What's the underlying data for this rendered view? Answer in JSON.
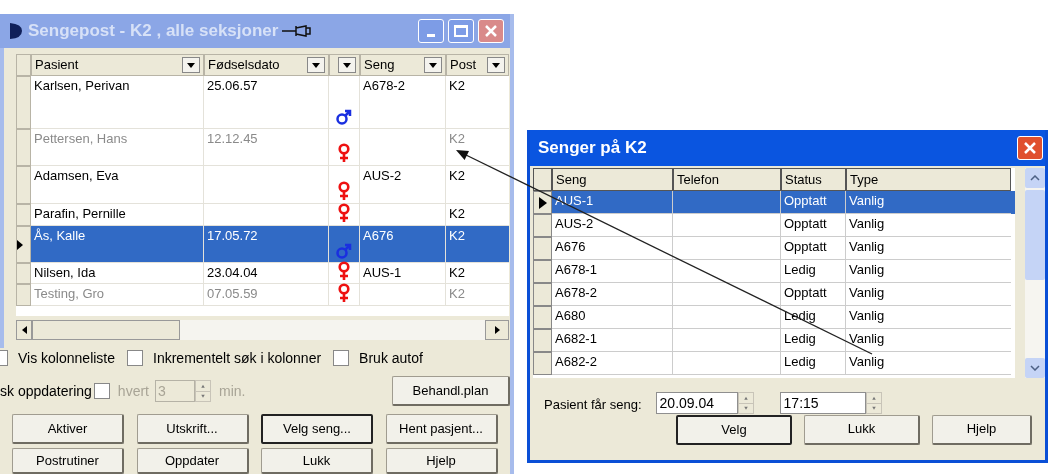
{
  "main_window": {
    "title": "Sengepost - K2 , alle seksjoner",
    "active": false,
    "columns": [
      {
        "kind": "text",
        "label": "Pasient"
      },
      {
        "kind": "text",
        "label": "Fødselsdato"
      },
      {
        "kind": "gender"
      },
      {
        "kind": "text",
        "label": "Seng"
      },
      {
        "kind": "text",
        "label": "Post"
      }
    ],
    "rows": [
      {
        "name": "Karlsen, Perivan",
        "birth_date": "25.06.57",
        "kind": "male",
        "bed": "A678-2",
        "post": "K2",
        "inactive": false,
        "selected": false
      },
      {
        "name": "Pettersen, Hans",
        "birth_date": "12.12.45",
        "kind": "female",
        "post": "K2",
        "inactive": true,
        "selected": false
      },
      {
        "name": "Adamsen, Eva",
        "kind": "female",
        "bed": "AUS-2",
        "post": "K2",
        "inactive": false,
        "selected": false
      },
      {
        "name": "Parafin, Pernille",
        "kind": "female",
        "post": "K2",
        "inactive": false,
        "selected": false
      },
      {
        "name": "Ås, Kalle",
        "birth_date": "17.05.72",
        "kind": "male",
        "bed": "A676",
        "post": "K2",
        "inactive": false,
        "selected": true
      },
      {
        "name": "Nilsen, Ida",
        "birth_date": "23.04.04",
        "kind": "female",
        "bed": "AUS-1",
        "post": "K2",
        "inactive": false,
        "selected": false
      },
      {
        "name": "Testing, Gro",
        "birth_date": "07.05.59",
        "kind": "female",
        "post": "K2",
        "inactive": true,
        "selected": false
      }
    ],
    "options": [
      {
        "label": "Vis kolonneliste",
        "checked": false
      },
      {
        "label": "Inkrementelt søk i kolonner",
        "checked": false
      },
      {
        "label": "Bruk autof",
        "checked": false
      }
    ],
    "auto_update": {
      "label": "sk oppdatering",
      "checked": false,
      "every_label": "hvert",
      "interval": "3",
      "unit": "min."
    },
    "side_button": "Behandl.plan",
    "buttons": [
      {
        "label": "Aktiver",
        "default": false
      },
      {
        "label": "Utskrift...",
        "default": false
      },
      {
        "label": "Velg seng...",
        "default": true
      },
      {
        "label": "Hent pasjent...",
        "default": false
      },
      {
        "label": "Postrutiner",
        "default": false
      },
      {
        "label": "Oppdater",
        "default": false
      },
      {
        "label": "Lukk",
        "default": false
      },
      {
        "label": "Hjelp",
        "default": false
      }
    ]
  },
  "bed_dialog": {
    "title": "Senger på K2",
    "active": true,
    "columns": [
      "Seng",
      "Telefon",
      "Status",
      "Type"
    ],
    "rows": [
      {
        "bed": "AUS-1",
        "status": "Opptatt",
        "type": "Vanlig",
        "selected": true
      },
      {
        "bed": "AUS-2",
        "status": "Opptatt",
        "type": "Vanlig",
        "selected": false
      },
      {
        "bed": "A676",
        "status": "Opptatt",
        "type": "Vanlig",
        "selected": false
      },
      {
        "bed": "A678-1",
        "status": "Ledig",
        "type": "Vanlig",
        "selected": false
      },
      {
        "bed": "A678-2",
        "status": "Opptatt",
        "type": "Vanlig",
        "selected": false
      },
      {
        "bed": "A680",
        "status": "Ledig",
        "type": "Vanlig",
        "selected": false
      },
      {
        "bed": "A682-1",
        "status": "Ledig",
        "type": "Vanlig",
        "selected": false
      },
      {
        "bed": "A682-2",
        "status": "Ledig",
        "type": "Vanlig",
        "selected": false
      }
    ],
    "assign_label": "Pasient får seng:",
    "date": "20.09.04",
    "time": "17:15",
    "buttons": [
      {
        "label": "Velg",
        "default": true
      },
      {
        "label": "Lukk",
        "default": false
      },
      {
        "label": "Hjelp",
        "default": false
      }
    ]
  }
}
